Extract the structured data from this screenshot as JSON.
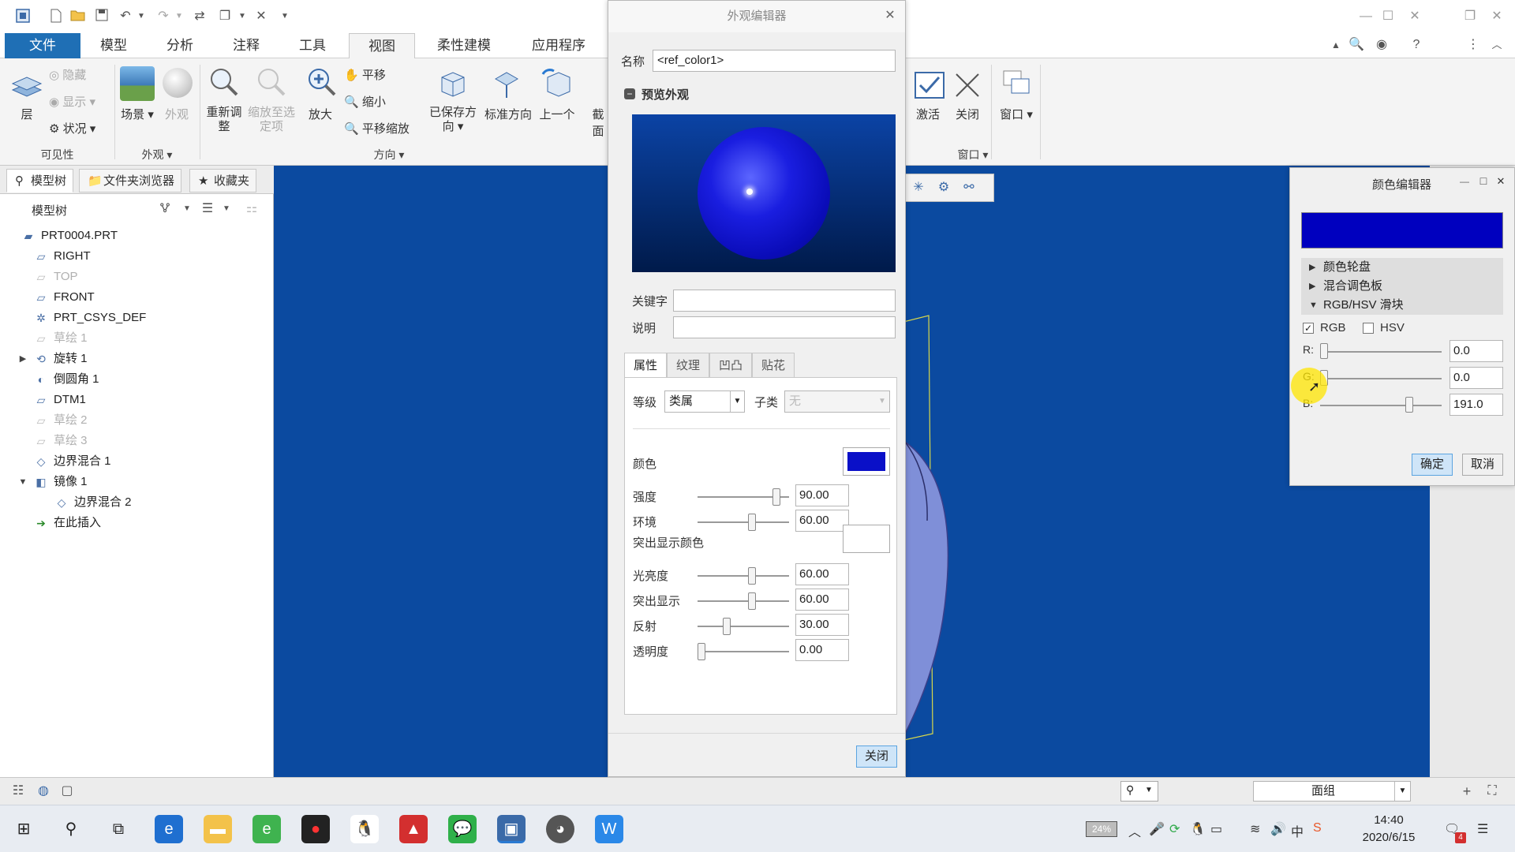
{
  "quick_access": {
    "icons": [
      "app-icon",
      "new-icon",
      "open-icon",
      "save-icon",
      "undo-icon",
      "redo-icon",
      "regenerate-icon",
      "windows-icon",
      "close-window-icon",
      "customize-icon"
    ]
  },
  "ribbon_tabs": [
    "文件",
    "模型",
    "分析",
    "注释",
    "工具",
    "视图",
    "柔性建模",
    "应用程序"
  ],
  "ribbon": {
    "layer": "层",
    "hide": "隐藏",
    "show": "显示",
    "status": "状况",
    "scene": "场景",
    "appearance": "外观",
    "refit": "重新调整",
    "zoom_to_selected": "缩放至选定项",
    "zoom_in": "放大",
    "pan": "平移",
    "zoom_out": "缩小",
    "pan_zoom": "平移缩放",
    "saved_orientations": "已保存方向",
    "standard_orientation": "标准方向",
    "previous": "上一个",
    "section": "截面",
    "activate": "激活",
    "close": "关闭",
    "window": "窗口",
    "group_visibility": "可见性",
    "group_appearance": "外观",
    "group_orientation": "方向",
    "group_window": "窗口"
  },
  "left_panel": {
    "tabs": [
      "模型树",
      "文件夹浏览器",
      "收藏夹"
    ],
    "tree_header": "模型树",
    "items": [
      {
        "label": "PRT0004.PRT",
        "dim": false
      },
      {
        "label": "RIGHT",
        "dim": false
      },
      {
        "label": "TOP",
        "dim": true
      },
      {
        "label": "FRONT",
        "dim": false
      },
      {
        "label": "PRT_CSYS_DEF",
        "dim": false
      },
      {
        "label": "草绘 1",
        "dim": true
      },
      {
        "label": "旋转 1",
        "dim": false
      },
      {
        "label": "倒圆角 1",
        "dim": false
      },
      {
        "label": "DTM1",
        "dim": false
      },
      {
        "label": "草绘 2",
        "dim": true
      },
      {
        "label": "草绘 3",
        "dim": true
      },
      {
        "label": "边界混合 1",
        "dim": false
      },
      {
        "label": "镜像 1",
        "dim": false
      },
      {
        "label": "边界混合 2",
        "dim": false
      },
      {
        "label": "在此插入",
        "dim": false
      }
    ]
  },
  "appearance_editor": {
    "title": "外观编辑器",
    "name_label": "名称",
    "name_value": "<ref_color1>",
    "preview_label": "预览外观",
    "keyword_label": "关键字",
    "keyword_value": "",
    "description_label": "说明",
    "description_value": "",
    "subtabs": [
      "属性",
      "纹理",
      "凹凸",
      "贴花"
    ],
    "level_label": "等级",
    "level_value": "类属",
    "subclass_label": "子类",
    "subclass_value": "无",
    "color_label": "颜色",
    "color_value": "#0a10c8",
    "highlight_color_label": "突出显示颜色",
    "properties": [
      {
        "label": "强度",
        "value": "90.00",
        "fraction": 0.9
      },
      {
        "label": "环境",
        "value": "60.00",
        "fraction": 0.6
      },
      {
        "label": "光亮度",
        "value": "60.00",
        "fraction": 0.6
      },
      {
        "label": "突出显示",
        "value": "60.00",
        "fraction": 0.6
      },
      {
        "label": "反射",
        "value": "30.00",
        "fraction": 0.3
      },
      {
        "label": "透明度",
        "value": "0.00",
        "fraction": 0.0
      }
    ],
    "close_button": "关闭"
  },
  "color_editor": {
    "title": "颜色编辑器",
    "swatch_color": "#0000bf",
    "sections": [
      "颜色轮盘",
      "混合调色板",
      "RGB/HSV 滑块"
    ],
    "rgb_label": "RGB",
    "rgb_checked": true,
    "hsv_label": "HSV",
    "hsv_checked": false,
    "channels": [
      {
        "label": "R:",
        "value": "0.0",
        "fraction": 0.0
      },
      {
        "label": "G:",
        "value": "0.0",
        "fraction": 0.0
      },
      {
        "label": "B:",
        "value": "191.0",
        "fraction": 0.749
      }
    ],
    "ok_button": "确定",
    "cancel_button": "取消"
  },
  "status_bar": {
    "filter_value": "面组"
  },
  "taskbar": {
    "battery": "24%",
    "time": "14:40",
    "date": "2020/6/15",
    "notification_count": "4"
  },
  "colors": {
    "viewport_bg": "#0b4aa0",
    "file_tab": "#1f6fb5",
    "preview_sphere": "#1a1ee0"
  }
}
